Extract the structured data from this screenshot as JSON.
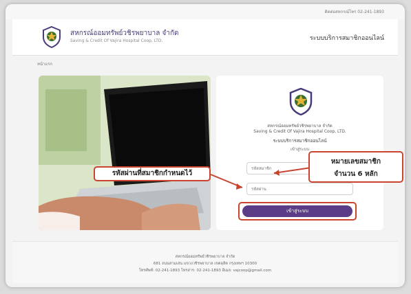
{
  "topbar": {
    "contact": "ติดต่อสหกรณ์โทร 02-241-1893"
  },
  "header": {
    "brand_th": "สหกรณ์ออมทรัพย์วชิรพยาบาล จำกัด",
    "brand_en": "Saving & Credit Of Vajira Hospital Coop, LTD.",
    "right_title": "ระบบบริการสมาชิกออนไลน์"
  },
  "breadcrumb": "หน้าแรก",
  "card": {
    "org_th": "สหกรณ์ออมทรัพย์วชิรพยาบาล จำกัด",
    "org_en": "Saving & Credit Of Vajira Hospital Coop, LTD.",
    "service": "ระบบบริการสมาชิกออนไลน์",
    "login_heading": "เข้าสู่ระบบ",
    "member_placeholder": "รหัสสมาชิก",
    "password_placeholder": "รหัสผ่าน",
    "login_button": "เข้าสู่ระบบ"
  },
  "callouts": {
    "member_line1": "หมายเลขสมาชิก",
    "member_line2": "จำนวน 6 หลัก",
    "password": "รหัสผ่านที่สมาชิกกำหนดไว้"
  },
  "footer": {
    "line1": "สหกรณ์ออมทรัพย์วชิรพยาบาล จำกัด",
    "line2": "681 ถนนสามเสน แขวงวชิรพยาบาล เขตดุสิต กรุงเทพฯ 10300",
    "line3": "โทรศัพท์: 02-241-1893 โทรสาร: 02-241-1893 อีเมล: vajcoop@gmail.com"
  },
  "colors": {
    "accent_purple": "#5b3c86",
    "callout_red": "#c9432e"
  }
}
